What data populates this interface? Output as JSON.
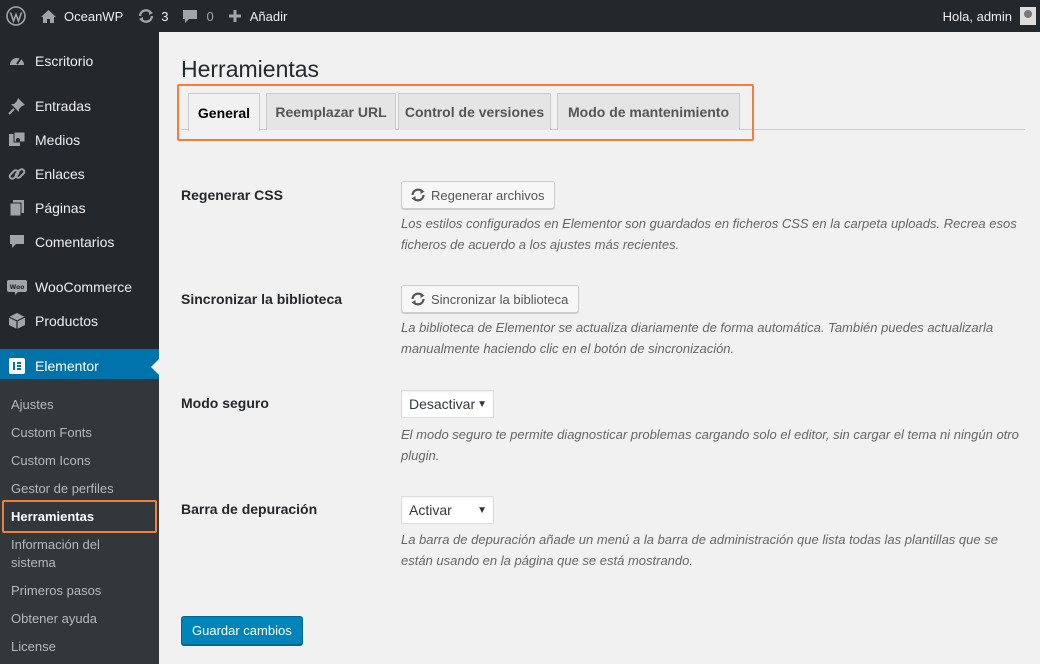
{
  "adminbar": {
    "site_name": "OceanWP",
    "updates_count": "3",
    "comments_count": "0",
    "add_new": "Añadir",
    "greeting": "Hola, admin"
  },
  "sidebar": {
    "items": [
      {
        "label": "Escritorio",
        "icon": "dashboard-icon"
      },
      {
        "label": "Entradas",
        "icon": "pin-icon"
      },
      {
        "label": "Medios",
        "icon": "media-icon"
      },
      {
        "label": "Enlaces",
        "icon": "link-icon"
      },
      {
        "label": "Páginas",
        "icon": "page-icon"
      },
      {
        "label": "Comentarios",
        "icon": "comment-icon"
      },
      {
        "label": "WooCommerce",
        "icon": "woocommerce-icon"
      },
      {
        "label": "Productos",
        "icon": "box-icon"
      },
      {
        "label": "Elementor",
        "icon": "elementor-icon"
      }
    ],
    "submenu": [
      "Ajustes",
      "Custom Fonts",
      "Custom Icons",
      "Gestor de perfiles",
      "Herramientas",
      "Información del sistema",
      "Primeros pasos",
      "Obtener ayuda",
      "License"
    ],
    "current_submenu": "Herramientas"
  },
  "page": {
    "title": "Herramientas",
    "tabs": [
      "General",
      "Reemplazar URL",
      "Control de versiones",
      "Modo de mantenimiento"
    ],
    "active_tab": "General"
  },
  "settings": {
    "regen_css": {
      "label": "Regenerar CSS",
      "button": "Regenerar archivos",
      "description": "Los estilos configurados en Elementor son guardados en ficheros CSS en la carpeta uploads. Recrea esos ficheros de acuerdo a los ajustes más recientes."
    },
    "sync_library": {
      "label": "Sincronizar la biblioteca",
      "button": "Sincronizar la biblioteca",
      "description": "La biblioteca de Elementor se actualiza diariamente de forma automática. También puedes actualizarla manualmente haciendo clic en el botón de sincronización."
    },
    "safe_mode": {
      "label": "Modo seguro",
      "value": "Desactivar",
      "description": "El modo seguro te permite diagnosticar problemas cargando solo el editor, sin cargar el tema ni ningún otro plugin."
    },
    "debug_bar": {
      "label": "Barra de depuración",
      "value": "Activar",
      "description": "La barra de depuración añade un menú a la barra de administración que lista todas las plantillas que se están usando en la página que se está mostrando."
    }
  },
  "save_button": "Guardar cambios",
  "colors": {
    "admin_bg": "#23282d",
    "accent": "#0073aa",
    "primary_button": "#0085ba",
    "highlight": "#f0803c"
  }
}
